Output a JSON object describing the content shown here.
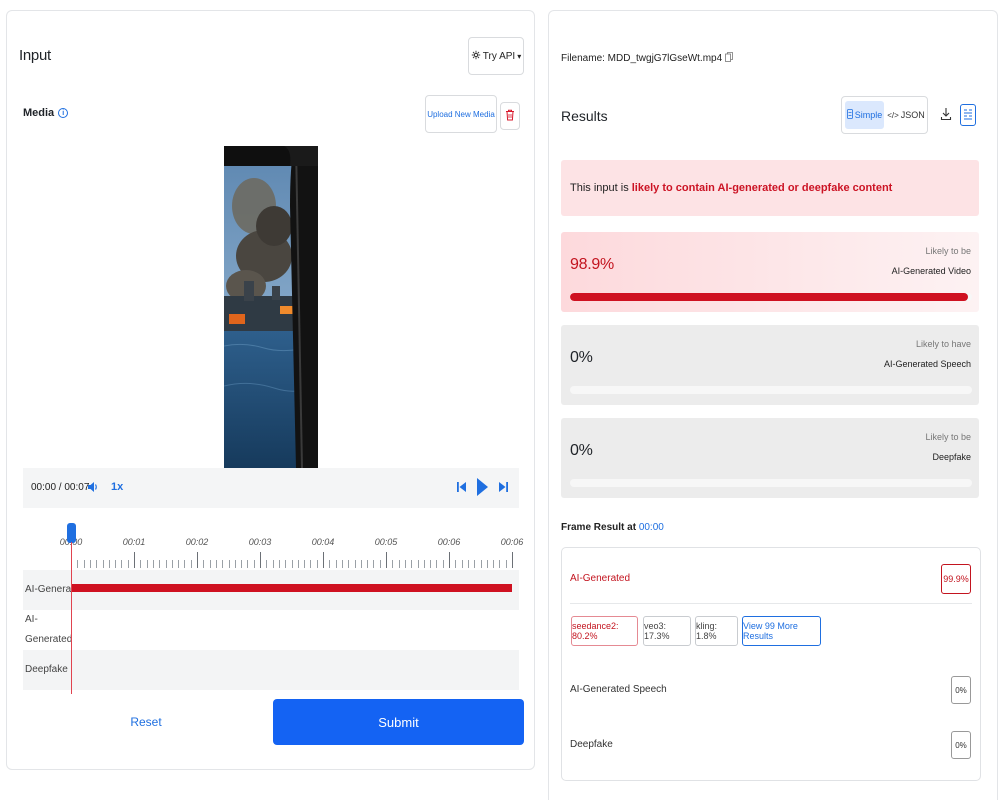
{
  "input": {
    "title": "Input",
    "try_api_label": "Try API",
    "media_label": "Media",
    "upload_label": "Upload New Media"
  },
  "player": {
    "time": "00:00 / 00:07",
    "speed": "1x",
    "progress": 0
  },
  "timeline": {
    "ticks": [
      "00:00",
      "00:01",
      "00:02",
      "00:03",
      "00:04",
      "00:05",
      "00:06",
      "00:06"
    ],
    "tracks": [
      {
        "label": "AI-Generated"
      },
      {
        "label": "AI-Generated Speech"
      },
      {
        "label": "Deepfake"
      }
    ]
  },
  "actions": {
    "reset_label": "Reset",
    "submit_label": "Submit"
  },
  "results": {
    "filename": "Filename: MDD_twgjG7lGseWt.mp4",
    "title": "Results",
    "view_simple": "Simple",
    "view_json": "JSON",
    "verdict_prefix": "This input is ",
    "verdict_highlight": "likely to contain AI-generated or deepfake content",
    "scores": [
      {
        "pct": "98.9%",
        "value": 0.989,
        "sub": "Likely to be",
        "name": "AI-Generated Video"
      },
      {
        "pct": "0%",
        "value": 0,
        "sub": "Likely to have",
        "name": "AI-Generated Speech"
      },
      {
        "pct": "0%",
        "value": 0,
        "sub": "Likely to be",
        "name": "Deepfake"
      }
    ],
    "frame_result_label": "Frame Result at ",
    "frame_result_time": "00:00",
    "frame": {
      "ai_label": "AI-Generated",
      "ai_value": "99.9%",
      "models": [
        "seedance2: 80.2%",
        "veo3: 17.3%",
        "kling: 1.8%"
      ],
      "more_label": "View 99 More Results",
      "speech_label": "AI-Generated Speech",
      "speech_value": "0%",
      "deepfake_label": "Deepfake",
      "deepfake_value": "0%"
    }
  },
  "colors": {
    "accent": "#1463f3",
    "danger": "#cf1121",
    "danger_bg": "#fde3e5"
  }
}
